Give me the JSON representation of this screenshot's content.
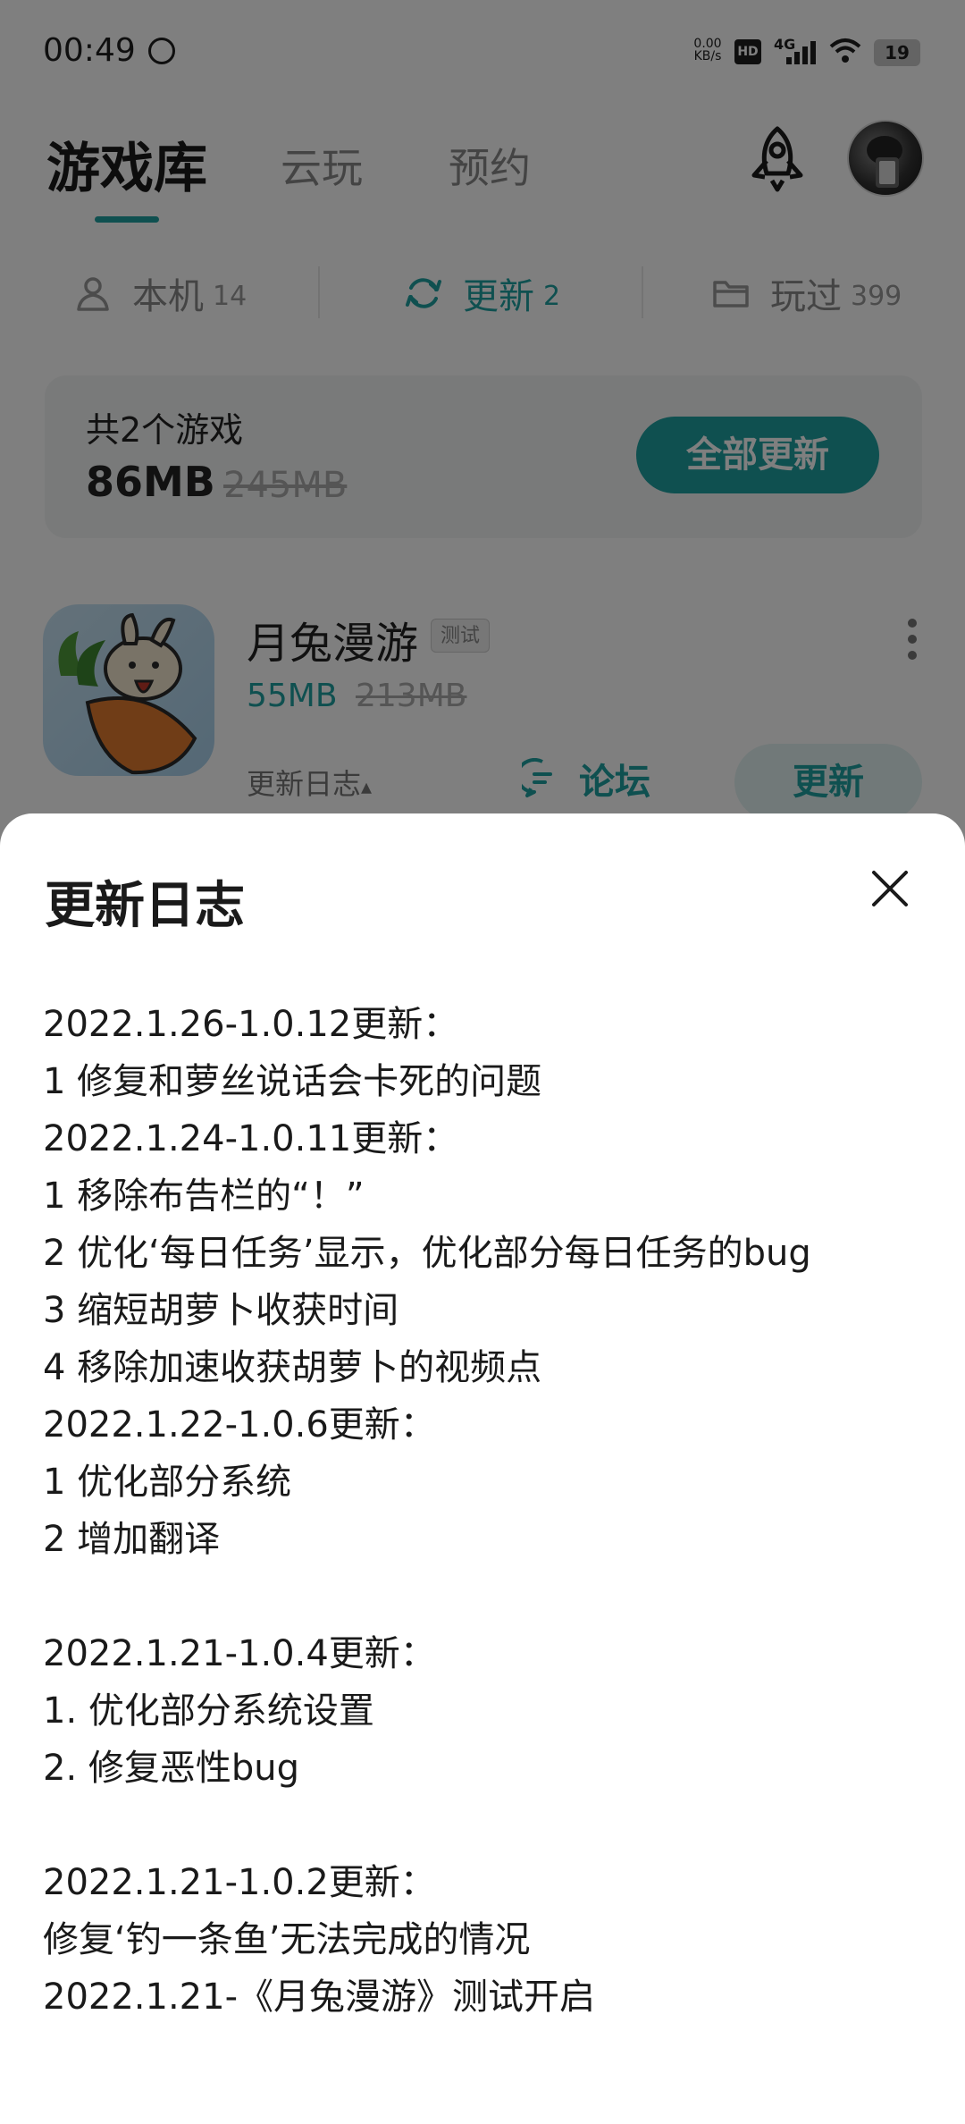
{
  "status_bar": {
    "time": "00:49",
    "speed_value": "0.00",
    "speed_unit": "KB/s",
    "hd": "HD",
    "network": "4G",
    "battery": "19"
  },
  "header": {
    "tabs": [
      "游戏库",
      "云玩",
      "预约"
    ],
    "active_tab_index": 0
  },
  "filters": [
    {
      "label": "本机",
      "count": "14",
      "icon": "person-icon"
    },
    {
      "label": "更新",
      "count": "2",
      "icon": "refresh-icon",
      "active": true
    },
    {
      "label": "玩过",
      "count": "399",
      "icon": "folder-icon"
    }
  ],
  "summary": {
    "count_text": "共2个游戏",
    "size": "86MB",
    "old_size": "245MB",
    "update_all_label": "全部更新"
  },
  "game": {
    "name": "月兔漫游",
    "tag": "测试",
    "size": "55MB",
    "old_size": "213MB",
    "changelog_label": "更新日志",
    "changelog_arrow": "▴",
    "forum_label": "论坛",
    "update_label": "更新"
  },
  "sheet": {
    "title": "更新日志",
    "lines": [
      "2022.1.26-1.0.12更新：",
      "1 修复和萝丝说话会卡死的问题",
      "2022.1.24-1.0.11更新：",
      "1 移除布告栏的“！”",
      "2 优化‘每日任务’显示，优化部分每日任务的bug",
      "3 缩短胡萝卜收获时间",
      "4 移除加速收获胡萝卜的视频点",
      "2022.1.22-1.0.6更新：",
      "1 优化部分系统",
      "2 增加翻译",
      "",
      "2022.1.21-1.0.4更新：",
      "1. 优化部分系统设置",
      "2. 修复恶性bug",
      "",
      "2022.1.21-1.0.2更新：",
      "修复‘钓一条鱼’无法完成的情况",
      "2022.1.21-《月兔漫游》测试开启"
    ]
  },
  "colors": {
    "accent": "#1fa0a0",
    "scrim": "rgba(0,0,0,0.5)"
  }
}
